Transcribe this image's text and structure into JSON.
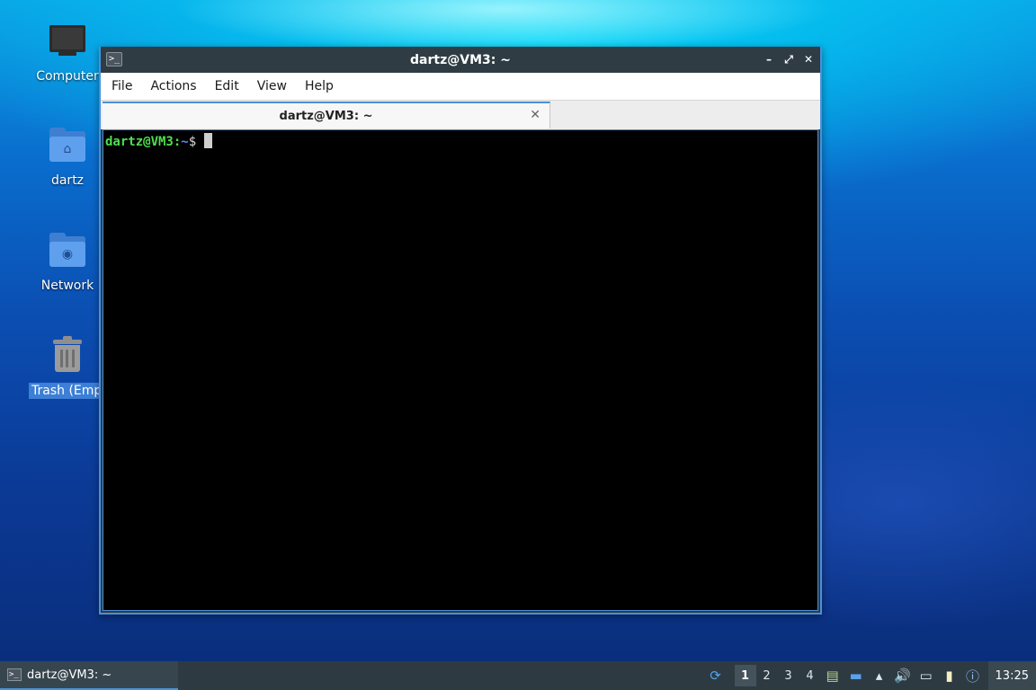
{
  "desktop": {
    "icons": [
      {
        "label": "Computer",
        "icon": "computer-icon"
      },
      {
        "label": "dartz",
        "icon": "home-folder-icon"
      },
      {
        "label": "Network",
        "icon": "network-folder-icon"
      },
      {
        "label": "Trash (Empt",
        "icon": "trash-icon"
      }
    ]
  },
  "window": {
    "title": "dartz@VM3: ~",
    "controls": {
      "minimize": "–",
      "maximize": "⤢",
      "close": "✕"
    },
    "menu": [
      "File",
      "Actions",
      "Edit",
      "View",
      "Help"
    ],
    "tab": {
      "title": "dartz@VM3: ~",
      "close": "✕"
    },
    "prompt": {
      "user_host": "dartz@VM3",
      "colon": ":",
      "path": "~",
      "symbol": "$"
    }
  },
  "taskbar": {
    "task": {
      "label": "dartz@VM3: ~"
    },
    "workspaces": [
      "1",
      "2",
      "3",
      "4"
    ],
    "active_workspace": "1",
    "clock": "13:25"
  },
  "colors": {
    "accent": "#4a90d9",
    "prompt_user": "#4ee04e",
    "prompt_path": "#5b8cff"
  }
}
